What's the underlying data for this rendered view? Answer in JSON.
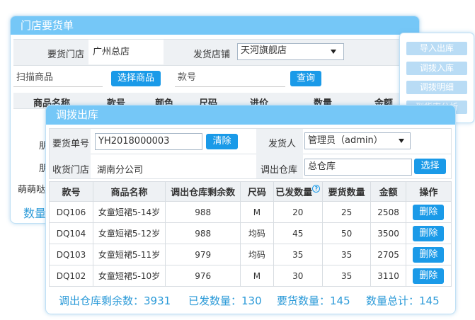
{
  "back": {
    "title": "门店要货单",
    "store_label": "要货门店",
    "store_value": "广州总店",
    "ship_store_label": "发货店铺",
    "ship_store_value": "天河旗舰店",
    "scan_placeholder": "扫描商品",
    "select_goods_button": "选择商品",
    "code_placeholder": "款号",
    "query_button": "查询",
    "columns": [
      "商品名称",
      "款号",
      "颜色",
      "尺码",
      "进价",
      "数量",
      "金额"
    ],
    "row_fragments": [
      "朋",
      "朋",
      "萌萌哒"
    ],
    "footer_fragment": "数量"
  },
  "side": {
    "items": [
      "导入出库",
      "调拨入库",
      "调拨明细",
      "到货率分析"
    ]
  },
  "front": {
    "title": "调拨出库",
    "order_no_label": "要货单号",
    "order_no_value": "YH2018000003",
    "clear_button": "清除",
    "shipper_label": "发货人",
    "shipper_value": "管理员（admin）",
    "receive_store_label": "收货门店",
    "receive_store_value": "湖南分公司",
    "out_wh_label": "调出仓库",
    "out_wh_value": "总仓库",
    "select_button": "选择",
    "columns": [
      "款号",
      "商品名称",
      "调出仓库剩余数",
      "尺码",
      "已发数量",
      "要货数量",
      "金额",
      "操作"
    ],
    "help_icon_glyph": "?",
    "rows": [
      {
        "code": "DQ106",
        "name": "女童短裙5-14岁",
        "remain": "988",
        "size": "M",
        "sent": "20",
        "req": "25",
        "amount": "2508",
        "action": "删除"
      },
      {
        "code": "DQ104",
        "name": "女童短裙5-12岁",
        "remain": "988",
        "size": "均码",
        "sent": "45",
        "req": "50",
        "amount": "3500",
        "action": "删除"
      },
      {
        "code": "DQ103",
        "name": "女童短裙5-11岁",
        "remain": "979",
        "size": "均码",
        "sent": "35",
        "req": "35",
        "amount": "2705",
        "action": "删除"
      },
      {
        "code": "DQ102",
        "name": "女童短裙5-10岁",
        "remain": "976",
        "size": "M",
        "sent": "30",
        "req": "35",
        "amount": "3110",
        "action": "删除"
      }
    ],
    "summary": {
      "remain": "调出仓库剩余数：3931",
      "sent": "已发数量：130",
      "req": "要货数量：145",
      "total": "数量总计：145"
    }
  }
}
